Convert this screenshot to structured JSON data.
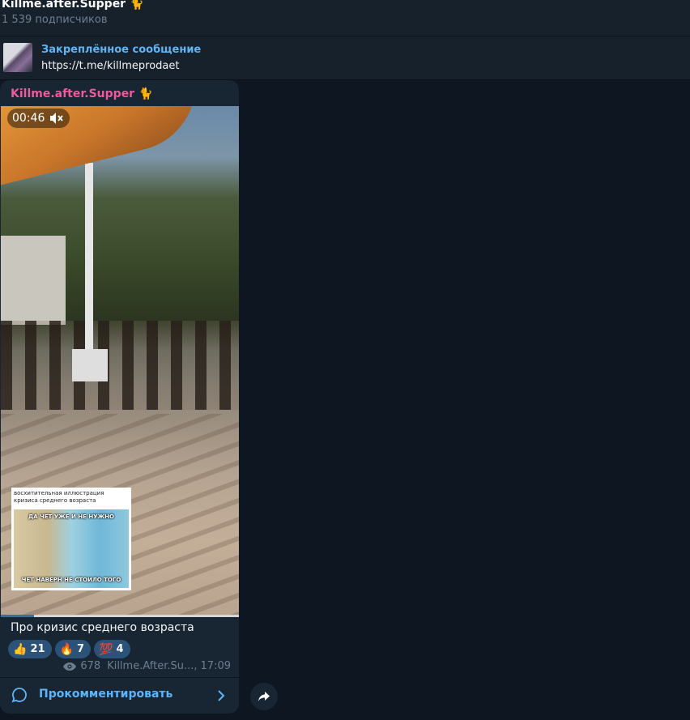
{
  "channel": {
    "title": "Killme.after.Supper 🐈",
    "subscribers": "1 539 подписчиков"
  },
  "pinned": {
    "title": "Закреплённое сообщение",
    "link": "https://t.me/killmeprodaet"
  },
  "message": {
    "author": "Killme.after.Supper 🐈",
    "video": {
      "duration": "00:46",
      "progress": 0.14,
      "meme_text": "восхитительная иллюстрация кризиса среднего возраста",
      "meme_top_caption": "ДА ЧЕТ УЖЕ И НЕ НУЖНО",
      "meme_bottom_caption": "ЧЕТ НАВЕРН НЕ СТОИЛО ТОГО"
    },
    "caption": "Про кризис среднего возраста",
    "reactions": [
      {
        "emoji": "👍",
        "count": "21"
      },
      {
        "emoji": "🔥",
        "count": "7"
      },
      {
        "emoji": "💯",
        "count": "4"
      }
    ],
    "views": "678",
    "signature": "Killme.After.Su...,",
    "time": "17:09",
    "comment_label": "Прокомментировать"
  },
  "colors": {
    "background": "#0e1621",
    "panel": "#17212b",
    "bubble": "#182533",
    "accent": "#5eb5f7",
    "author": "#ee5a9c",
    "reaction_bg": "#2b5278"
  }
}
